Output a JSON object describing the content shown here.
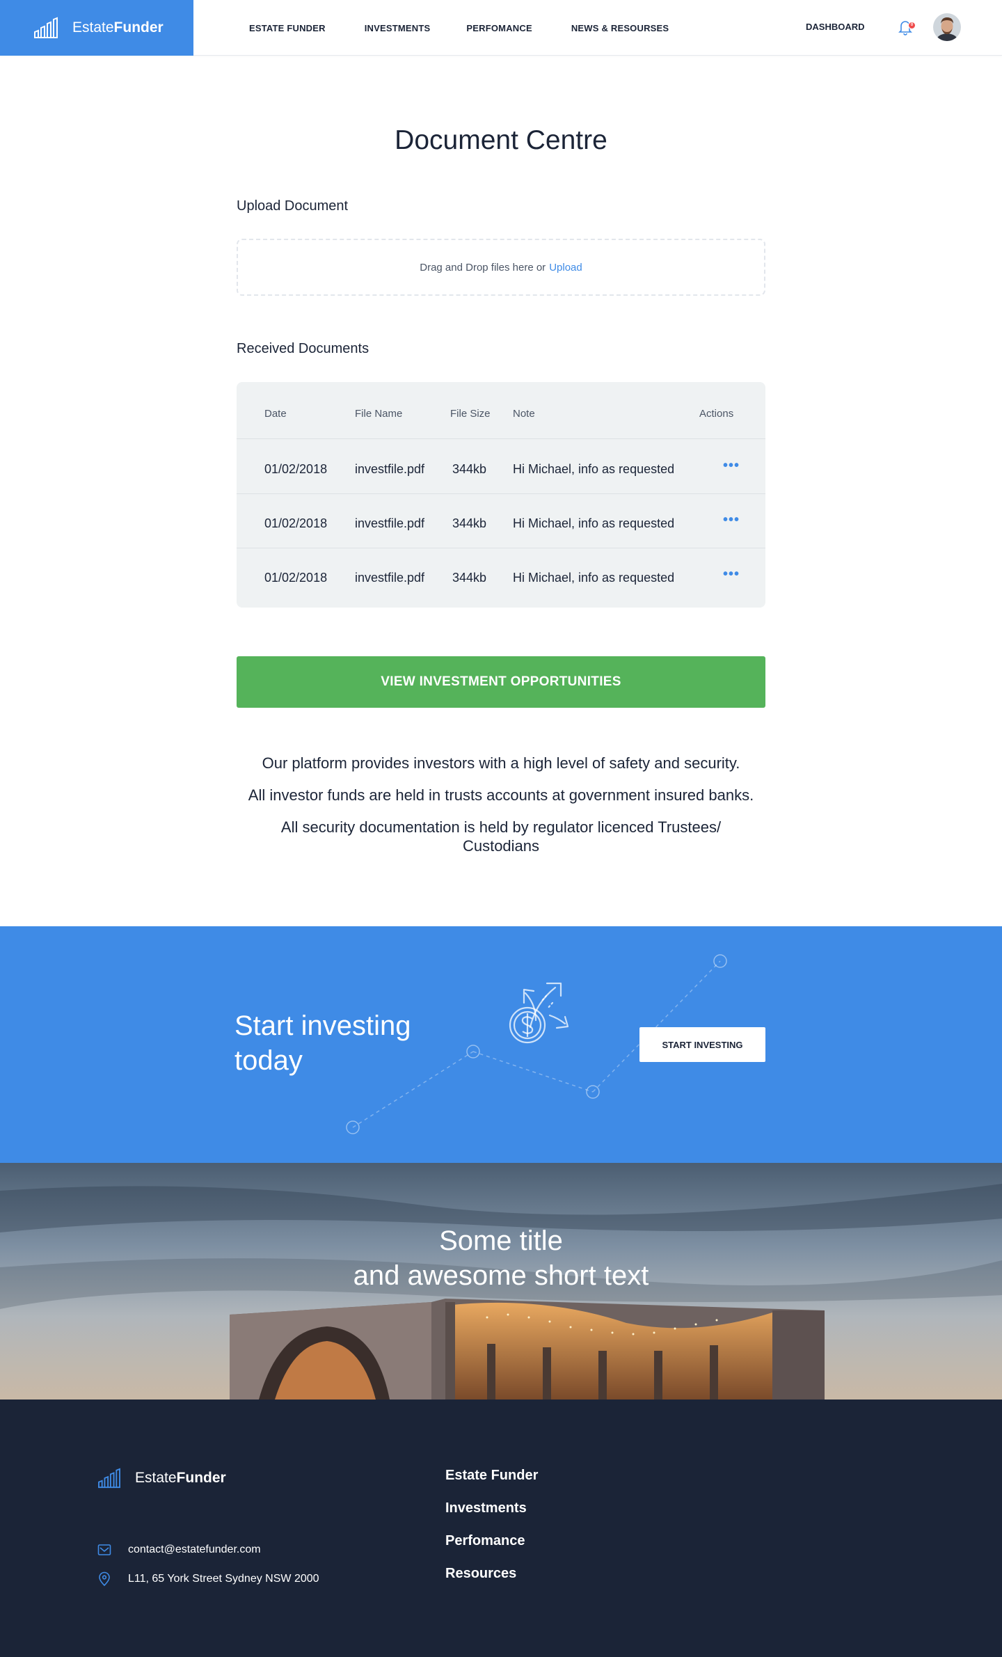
{
  "header": {
    "brand_prefix": "Estate",
    "brand_bold": "Funder",
    "nav": [
      "ESTATE FUNDER",
      "INVESTMENTS",
      "PERFOMANCE",
      "NEWS & RESOURSES"
    ],
    "dashboard": "DASHBOARD",
    "notification_count": "0"
  },
  "main": {
    "title": "Document Centre",
    "upload_heading": "Upload Document",
    "dropzone_text": "Drag and Drop files here or",
    "dropzone_link": "Upload",
    "received_heading": "Received Documents",
    "columns": [
      "Date",
      "File Name",
      "File Size",
      "Note",
      "Actions"
    ],
    "rows": [
      {
        "date": "01/02/2018",
        "name": "investfile.pdf",
        "size": "344kb",
        "note": "Hi Michael, info as requested",
        "action": "•••"
      },
      {
        "date": "01/02/2018",
        "name": "investfile.pdf",
        "size": "344kb",
        "note": "Hi Michael, info as requested",
        "action": "•••"
      },
      {
        "date": "01/02/2018",
        "name": "investfile.pdf",
        "size": "344kb",
        "note": "Hi Michael, info as requested",
        "action": "•••"
      }
    ],
    "cta_label": "VIEW INVESTMENT OPPORTUNITIES",
    "info": [
      "Our platform provides investors with a high level of safety and security.",
      "All investor funds are held in trusts accounts at government insured banks.",
      "All security documentation is held by regulator licenced Trustees/ Custodians"
    ]
  },
  "banner": {
    "title_line1": "Start investing",
    "title_line2": "today",
    "button": "START INVESTING"
  },
  "photo": {
    "title_line1": "Some title",
    "title_line2": "and awesome short text"
  },
  "footer": {
    "brand_prefix": "Estate",
    "brand_bold": "Funder",
    "email": "contact@estatefunder.com",
    "address": "L11, 65 York Street Sydney NSW 2000",
    "links": [
      "Estate Funder",
      "Investments",
      "Perfomance",
      "Resources"
    ]
  },
  "colors": {
    "brand_blue": "#3f8be6",
    "cta_green": "#55b35a",
    "footer_navy": "#1b2437",
    "badge_red": "#ef4b4b"
  },
  "icons": [
    "bar-chart-logo-icon",
    "bell-icon",
    "more-dots-icon",
    "investment-arrows-icon",
    "dollar-coin-icon",
    "mail-icon",
    "location-pin-icon"
  ]
}
